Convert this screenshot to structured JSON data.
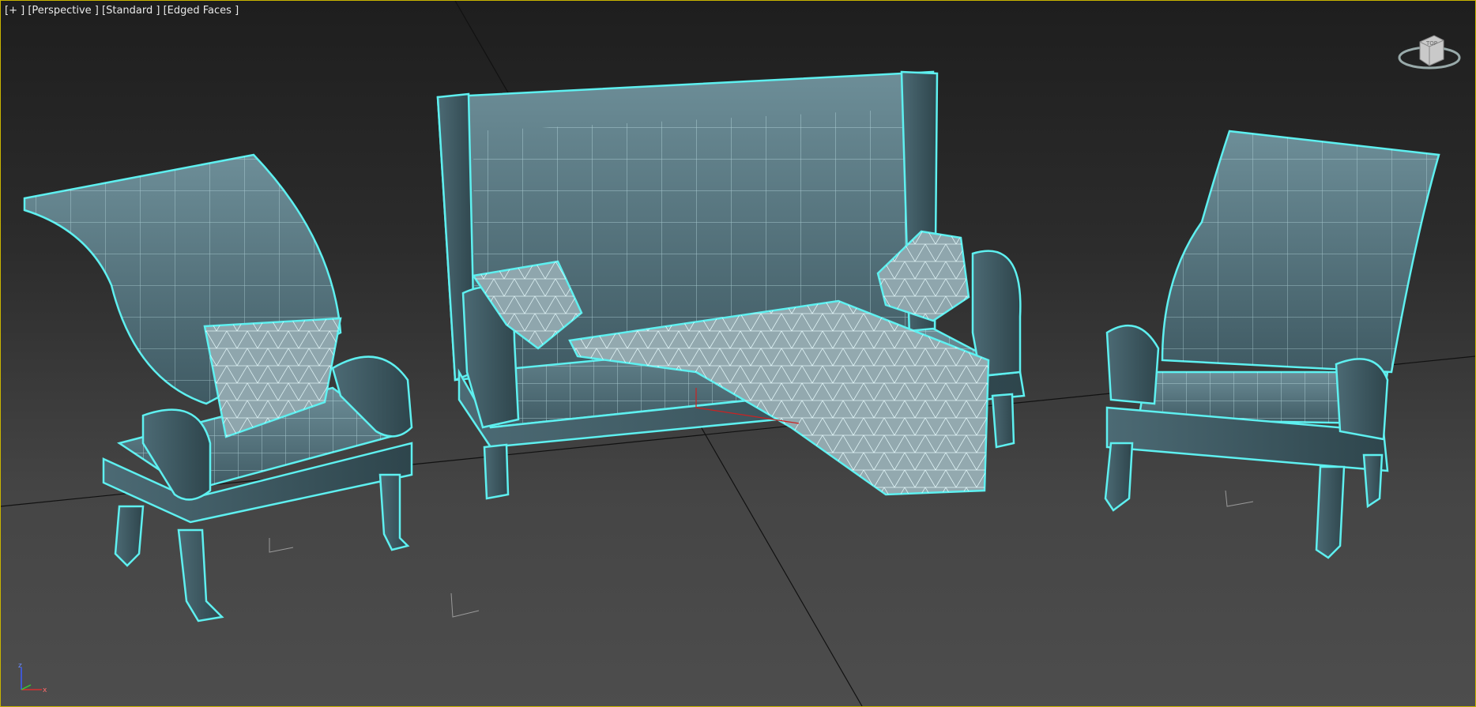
{
  "viewport": {
    "label_plus": "[+ ]",
    "label_view": "[Perspective ]",
    "label_shading": "[Standard ]",
    "label_edges": "[Edged Faces ]"
  },
  "viewcube": {
    "face_label": "TOP"
  },
  "axis_tripod": {
    "x": "x",
    "z": "z"
  },
  "scene_objects": [
    {
      "name": "armchair-left"
    },
    {
      "name": "sofa"
    },
    {
      "name": "armchair-right"
    }
  ],
  "colors": {
    "wire": "#bff6ff",
    "selection_outline": "#5ef0f0",
    "surface": "#5c7f8a",
    "viewport_border": "#c8b400"
  }
}
